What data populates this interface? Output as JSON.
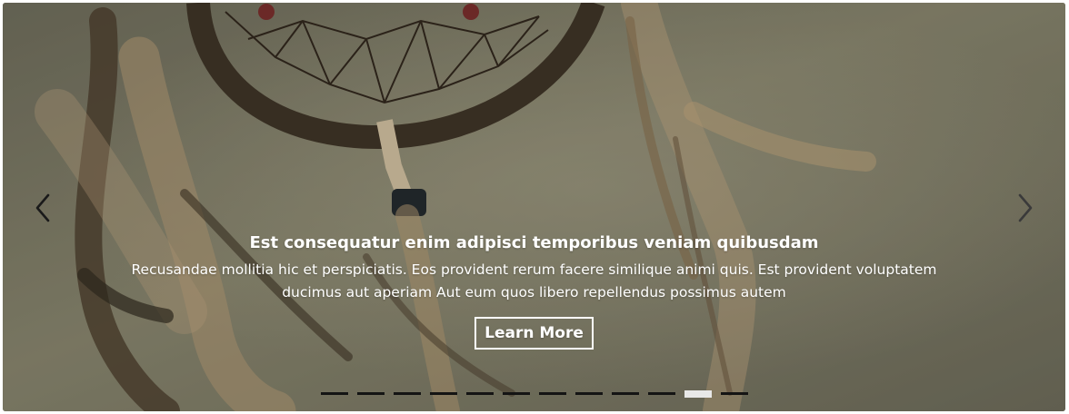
{
  "slide": {
    "title": "Est consequatur enim adipisci temporibus veniam quibusdam",
    "text": "Recusandae mollitia hic et perspiciatis. Eos provident rerum facere similique animi quis. Est provident voluptatem ducimus aut aperiam Aut eum quos libero repellendus possimus autem",
    "button_label": "Learn More",
    "image_subject": "dream catcher with feathers"
  },
  "controls": {
    "prev_icon": "chevron-left-icon",
    "next_icon": "chevron-right-icon"
  },
  "indicators": {
    "count": 12,
    "active_index": 10
  },
  "colors": {
    "caption_text": "#ffffff",
    "indicator_inactive": "#141414",
    "indicator_active": "#e8e8e8",
    "arrow": "#1a1a1a"
  }
}
